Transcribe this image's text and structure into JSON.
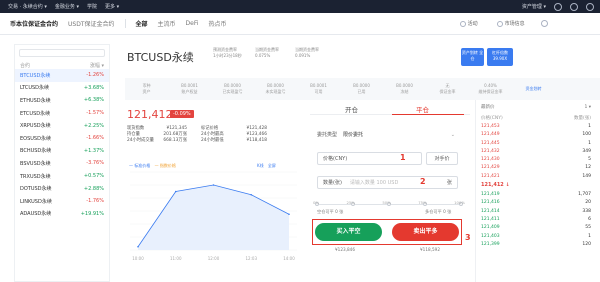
{
  "topnav": {
    "items": [
      "交易 · 永续合约 ▾",
      "金融业务 ▾",
      "学院",
      "更多 ▾"
    ],
    "right": "资产管理 ▾"
  },
  "tabs": {
    "left": [
      "币本位保证金合约",
      "USDT保证金合约"
    ],
    "right": [
      "全部",
      "主流币",
      "DeFi",
      "热点币"
    ],
    "extras": [
      "活动",
      "市场信息"
    ]
  },
  "sidebar": {
    "head": [
      "合约",
      "涨幅 ▾"
    ],
    "rows": [
      {
        "name": "BTCUSD永续",
        "chg": "-1.26%",
        "dir": "down",
        "sel": true
      },
      {
        "name": "LTCUSD永续",
        "chg": "+3.68%",
        "dir": "up"
      },
      {
        "name": "ETHUSD永续",
        "chg": "+6.38%",
        "dir": "up"
      },
      {
        "name": "ETCUSD永续",
        "chg": "-1.57%",
        "dir": "down"
      },
      {
        "name": "XRPUSD永续",
        "chg": "+2.25%",
        "dir": "up"
      },
      {
        "name": "EOSUSD永续",
        "chg": "-1.66%",
        "dir": "down"
      },
      {
        "name": "BCHUSD永续",
        "chg": "+1.37%",
        "dir": "up"
      },
      {
        "name": "BSVUSD永续",
        "chg": "-3.76%",
        "dir": "down"
      },
      {
        "name": "TRXUSD永续",
        "chg": "+0.57%",
        "dir": "up"
      },
      {
        "name": "DOTUSD永续",
        "chg": "+2.88%",
        "dir": "up"
      },
      {
        "name": "LINKUSD永续",
        "chg": "-1.76%",
        "dir": "down"
      },
      {
        "name": "ADAUSD永续",
        "chg": "+19.91%",
        "dir": "up"
      }
    ]
  },
  "header": {
    "name": "BTCUSD永续",
    "kv": [
      {
        "l": "预测资金费率",
        "v": "1小时23分18秒"
      },
      {
        "l": "当期资金费率",
        "v": "0.075%"
      },
      {
        "l": "当期资金费率",
        "v": "0.091%"
      }
    ],
    "buttons": [
      "资产划转 全仓",
      "杠杆倍数 39.90X"
    ]
  },
  "stats": {
    "cells": [
      {
        "l": "币种",
        "v": "资产"
      },
      {
        "l": "B0.0001",
        "v": "账户权益"
      },
      {
        "l": "B0.0000",
        "v": "已实现盈亏"
      },
      {
        "l": "B0.0000",
        "v": "未实现盈亏"
      },
      {
        "l": "B0.0001",
        "v": "可用"
      },
      {
        "l": "B0.0000",
        "v": "已用"
      },
      {
        "l": "B0.0000",
        "v": "冻结"
      },
      {
        "l": "无",
        "v": "保证金率"
      },
      {
        "l": "0.40%",
        "v": "维持保证金率"
      },
      {
        "l": "资金划转",
        "v": ""
      }
    ]
  },
  "price": {
    "last": "121,412",
    "change": "-0.09%"
  },
  "mini": [
    [
      "现货指数",
      "¥121,345",
      "标记价格",
      "¥121,428"
    ],
    [
      "持仓量",
      "201.68万张",
      "24小时最高",
      "¥123,466"
    ],
    [
      "24小时成交量",
      "668.13万张",
      "24小时最低",
      "¥118,418"
    ]
  ],
  "chart": {
    "legend": [
      "— 标准价格",
      "— 指数价格"
    ],
    "options": [
      "K线",
      "全屏"
    ],
    "xticks": [
      "10:00",
      "11:00",
      "12:00",
      "12:03",
      "14:00"
    ],
    "yticks": [
      "122,000.00",
      "121,800.00",
      "121,600.00",
      "121,400.00",
      "121,200.00",
      "121,000.00",
      "120,800.00"
    ]
  },
  "chart_data": {
    "type": "line",
    "title": "",
    "x": [
      "10:00",
      "11:00",
      "12:00",
      "12:03",
      "14:00"
    ],
    "series": [
      {
        "name": "标准价格",
        "values": [
          120850,
          121700,
          121800,
          121650,
          121350
        ]
      }
    ],
    "ylim": [
      120800,
      122000
    ],
    "xlabel": "",
    "ylabel": ""
  },
  "trade": {
    "tabs": [
      "开仓",
      "平仓"
    ],
    "type_label": "委托类型",
    "type_value": "限价委托",
    "price_label": "价格(CNY)",
    "price_suffix": "对手价",
    "qty_label": "数量(张)",
    "qty_placeholder": "请输入数量 100 USD",
    "qty_unit": "张",
    "marks": [
      "0%",
      "25%",
      "50%",
      "75%",
      "100%"
    ],
    "avail_left": "空仓可平 0 张",
    "avail_right": "多仓可平 0 张",
    "buy": "买入平空",
    "sell": "卖出平多",
    "foot_left": "¥123,846",
    "foot_right": "¥118,592",
    "numbers": [
      "1",
      "2",
      "3"
    ]
  },
  "book": {
    "head": [
      "最新价",
      "1 ▾"
    ],
    "cols": [
      "价格(CNY)",
      "数量(张)"
    ],
    "asks": [
      [
        "121,453",
        "1"
      ],
      [
        "121,449",
        "100"
      ],
      [
        "121,445",
        "1"
      ],
      [
        "121,432",
        "349"
      ],
      [
        "121,430",
        "5"
      ],
      [
        "121,429",
        "12"
      ],
      [
        "121,421",
        "149"
      ]
    ],
    "last": "121,412 ↓",
    "bids": [
      [
        "121,419",
        "1,707"
      ],
      [
        "121,416",
        "20"
      ],
      [
        "121,414",
        "338"
      ],
      [
        "121,411",
        "6"
      ],
      [
        "121,409",
        "55"
      ],
      [
        "121,403",
        "1"
      ],
      [
        "121,399",
        "120"
      ]
    ]
  }
}
